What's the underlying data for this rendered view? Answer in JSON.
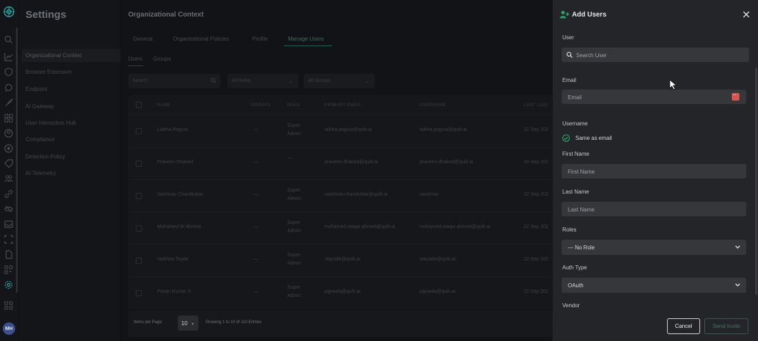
{
  "sidebar": {
    "title": "Settings",
    "items": [
      {
        "label": "Organizational Context",
        "active": true
      },
      {
        "label": "Browser Extension"
      },
      {
        "label": "Endpoint"
      },
      {
        "label": "AI Gateway"
      },
      {
        "label": "User Interaction Hub"
      },
      {
        "label": "Compliance"
      },
      {
        "label": "Detection Policy"
      },
      {
        "label": "AI Telemetry"
      }
    ],
    "avatar_initials": "MH"
  },
  "main": {
    "title": "Organizational Context",
    "tabs": [
      "General",
      "Organizational Policies",
      "Profile",
      "Manage Users"
    ],
    "active_tab": "Manage Users",
    "subtabs": [
      "Users",
      "Groups"
    ],
    "search_placeholder": "Search",
    "role_filter": "All Roles",
    "group_filter": "All Groups",
    "columns": [
      "NAME",
      "GROUPS",
      "ROLE",
      "PRIMARY EMAIL",
      "USERNAME",
      "LAST LOGI"
    ],
    "rows": [
      {
        "name": "Lalitha Pogula",
        "groups": "—",
        "role": [
          "Super",
          "Admin"
        ],
        "email": "lalitha.pogula@quilr.ai",
        "username": "lalitha.pogula@quilr.ai",
        "last_login": "22 Sep 202"
      },
      {
        "name": "Praveen Dhaked",
        "groups": "—",
        "role": [
          "—"
        ],
        "email": "praveen.dhaked@quilr.ai",
        "username": "praveen.dhaked@quilr.ai",
        "last_login": "16 Sep 202"
      },
      {
        "name": "Vaishnav Chandurkar",
        "groups": "—",
        "role": [
          "Super",
          "Admin"
        ],
        "email": "vaishnav.chandurkar@quilr.ai",
        "username": "vaishnav",
        "last_login": "22 Sep 202"
      },
      {
        "name": "Mohamed W Ahmed",
        "groups": "—",
        "role": [
          "Super",
          "Admin"
        ],
        "email": "mohamed.waqar.ahmed@quilr.ai",
        "username": "mohamed.waqar.ahmed@quilr.ai",
        "last_login": "22 Sep 202"
      },
      {
        "name": "Vaibhav Tayde",
        "groups": "—",
        "role": [
          "Super",
          "Admin"
        ],
        "email": "vtayade@quilr.ai",
        "username": "vtayade@quilr.ai",
        "last_login": "22 Sep 202"
      },
      {
        "name": "Pavan Kumar S",
        "groups": "—",
        "role": [
          "Super",
          "Admin"
        ],
        "email": "pgowda@quilr.ai",
        "username": "pgowda@quilr.ai",
        "last_login": "22 Sep 202"
      }
    ],
    "items_per_page_label": "Items per Page",
    "items_per_page": "10",
    "showing": "Showing 1 to 10 of 110 Entries"
  },
  "drawer": {
    "title": "Add Users",
    "user_label": "User",
    "search_user_placeholder": "Search User",
    "email_label": "Email",
    "email_placeholder": "Email",
    "username_label": "Username",
    "same_as_email": "Same as email",
    "first_name_label": "First Name",
    "first_name_placeholder": "First Name",
    "last_name_label": "Last Name",
    "last_name_placeholder": "Last Name",
    "roles_label": "Roles",
    "roles_value": "— No Role",
    "auth_type_label": "Auth Type",
    "auth_type_value": "OAuth",
    "vendor_label": "Vendor",
    "cancel": "Cancel",
    "send_invite": "Send Invite"
  },
  "colors": {
    "accent": "#2f9e6b",
    "badge": "#d9534f"
  }
}
